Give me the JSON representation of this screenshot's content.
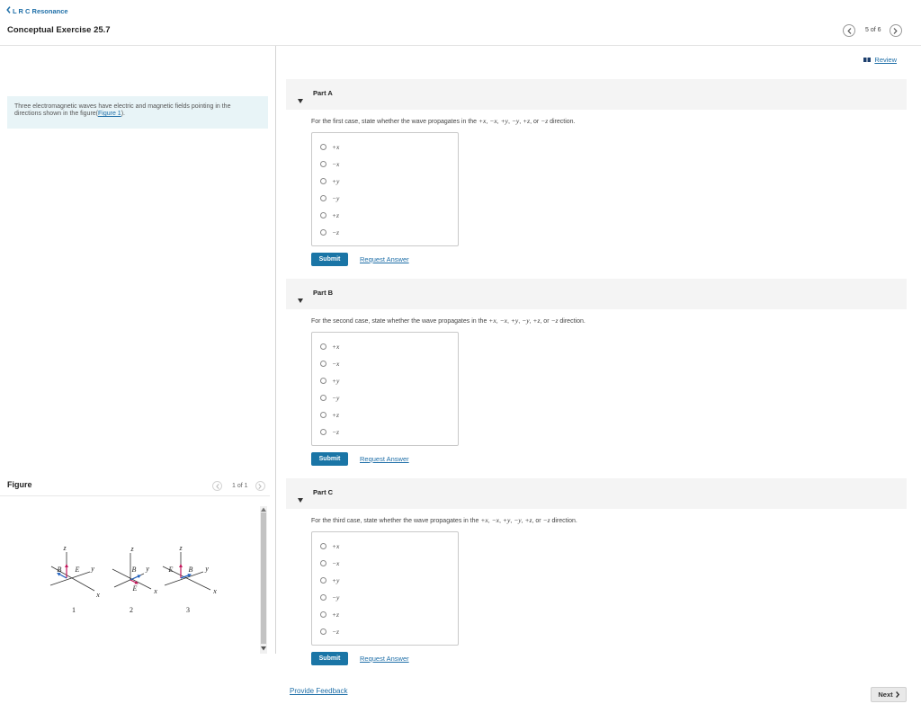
{
  "header": {
    "back_label": "L R C Resonance",
    "title": "Conceptual Exercise 25.7",
    "pager_text": "5 of 6"
  },
  "review": {
    "label": "Review"
  },
  "intro": {
    "text": "Three electromagnetic waves have electric and magnetic fields pointing in the directions shown in the figure(",
    "figure_link": "Figure 1",
    "text_end": ")."
  },
  "figure_panel": {
    "heading": "Figure",
    "pager_text": "1 of 1",
    "cases": [
      {
        "number": "1",
        "z": "z",
        "y": "y",
        "x": "x",
        "e": "E",
        "b": "B"
      },
      {
        "number": "2",
        "z": "z",
        "y": "y",
        "x": "x",
        "e": "E",
        "b": "B"
      },
      {
        "number": "3",
        "z": "z",
        "y": "y",
        "x": "x",
        "e": "E",
        "b": "B"
      }
    ]
  },
  "parts": [
    {
      "label": "Part A",
      "question": [
        "For the first case, state whether the wave propagates in the ",
        "+x",
        ", ",
        "−x",
        ", ",
        "+y",
        ", ",
        "−y",
        ", ",
        "+z",
        ", or ",
        "−z",
        " direction."
      ],
      "options": [
        "+x",
        "−x",
        "+y",
        "−y",
        "+z",
        "−z"
      ],
      "submit_label": "Submit",
      "request_label": "Request Answer"
    },
    {
      "label": "Part B",
      "question": [
        "For the second case, state whether the wave propagates in the ",
        "+x",
        ", ",
        "−x",
        ", ",
        "+y",
        ", ",
        "−y",
        ", ",
        "+z",
        ", or ",
        "−z",
        " direction."
      ],
      "options": [
        "+x",
        "−x",
        "+y",
        "−y",
        "+z",
        "−z"
      ],
      "submit_label": "Submit",
      "request_label": "Request Answer"
    },
    {
      "label": "Part C",
      "question": [
        "For the third case, state whether the wave propagates in the ",
        "+x",
        ", ",
        "−x",
        ", ",
        "+y",
        ", ",
        "−y",
        ", ",
        "+z",
        ", or ",
        "−z",
        " direction."
      ],
      "options": [
        "+x",
        "−x",
        "+y",
        "−y",
        "+z",
        "−z"
      ],
      "submit_label": "Submit",
      "request_label": "Request Answer"
    }
  ],
  "footer": {
    "feedback_label": "Provide Feedback",
    "next_label": "Next"
  },
  "colors": {
    "link": "#1f6fa8",
    "submit_button": "#1a75a6",
    "part_header_bg": "#f4f4f4",
    "intro_bg": "#e8f4f7",
    "e_field": "#c2185b",
    "b_field": "#1e5fbf"
  },
  "icons": {
    "back": "chevron-left-icon",
    "previous": "chevron-left-icon",
    "next": "chevron-right-icon",
    "review": "review-icon",
    "part_toggle": "caret-down-icon"
  }
}
